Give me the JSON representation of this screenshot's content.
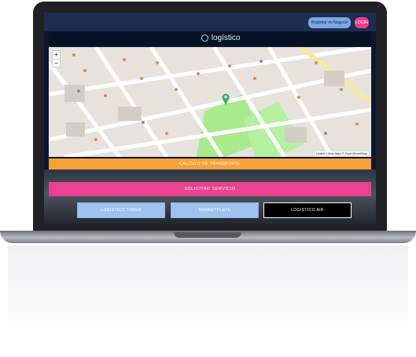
{
  "header": {
    "register_label": "Registrar mi Negocio",
    "login_label": "LOGIN"
  },
  "brand": {
    "logo_text": "logístico"
  },
  "map": {
    "zoom_in": "+",
    "zoom_out": "−",
    "attribution": "Leaflet | Map data © OpenStreetMap"
  },
  "actions": {
    "calc_label": "CALCULO DE TRANSPORTE",
    "service_label": "SOLICITAR SERVICIO"
  },
  "bottom": {
    "token_label": "LOGISTICO TOKEN",
    "market_label": "MARKETPLETE",
    "air_label": "LOGISTICO AIR"
  },
  "colors": {
    "screen_bg": "#0c1730",
    "register": "#7ca6ea",
    "login": "#ea3d8b",
    "calc": "#f5a23a",
    "service": "#e9428f",
    "token": "#9fc2f0",
    "air": "#000000"
  }
}
